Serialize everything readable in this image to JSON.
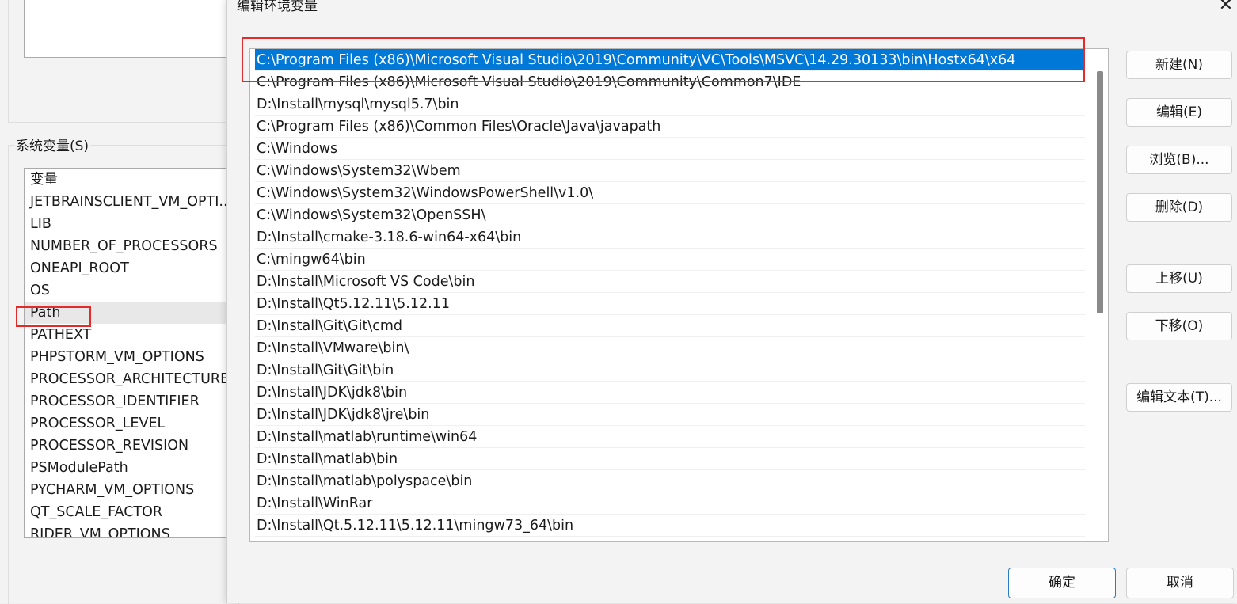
{
  "background_window": {
    "group_label": "系统变量(S)",
    "column_header": "变量",
    "variables": [
      "JETBRAINSCLIENT_VM_OPTI...",
      "LIB",
      "NUMBER_OF_PROCESSORS",
      "ONEAPI_ROOT",
      "OS",
      "Path",
      "PATHEXT",
      "PHPSTORM_VM_OPTIONS",
      "PROCESSOR_ARCHITECTURE",
      "PROCESSOR_IDENTIFIER",
      "PROCESSOR_LEVEL",
      "PROCESSOR_REVISION",
      "PSModulePath",
      "PYCHARM_VM_OPTIONS",
      "QT_SCALE_FACTOR",
      "RIDER_VM_OPTIONS"
    ],
    "selected_variable": "Path"
  },
  "dialog": {
    "title": "编辑环境变量",
    "close_glyph": "✕",
    "paths": [
      "C:\\Program Files (x86)\\Microsoft Visual Studio\\2019\\Community\\VC\\Tools\\MSVC\\14.29.30133\\bin\\Hostx64\\x64",
      "C:\\Program Files (x86)\\Microsoft Visual Studio\\2019\\Community\\Common7\\IDE",
      "D:\\Install\\mysql\\mysql5.7\\bin",
      "C:\\Program Files (x86)\\Common Files\\Oracle\\Java\\javapath",
      "C:\\Windows",
      "C:\\Windows\\System32\\Wbem",
      "C:\\Windows\\System32\\WindowsPowerShell\\v1.0\\",
      "C:\\Windows\\System32\\OpenSSH\\",
      "D:\\Install\\cmake-3.18.6-win64-x64\\bin",
      "C:\\mingw64\\bin",
      "D:\\Install\\Microsoft VS Code\\bin",
      "D:\\Install\\Qt5.12.11\\5.12.11",
      "D:\\Install\\Git\\Git\\cmd",
      "D:\\Install\\VMware\\bin\\",
      "D:\\Install\\Git\\Git\\bin",
      "D:\\Install\\JDK\\jdk8\\bin",
      "D:\\Install\\JDK\\jdk8\\jre\\bin",
      "D:\\Install\\matlab\\runtime\\win64",
      "D:\\Install\\matlab\\bin",
      "D:\\Install\\matlab\\polyspace\\bin",
      "D:\\Install\\WinRar",
      "D:\\Install\\Qt.5.12.11\\5.12.11\\mingw73_64\\bin"
    ],
    "selected_index": 0,
    "buttons": {
      "new": "新建(N)",
      "edit": "编辑(E)",
      "browse": "浏览(B)...",
      "delete": "删除(D)",
      "move_up": "上移(U)",
      "move_down": "下移(O)",
      "edit_text": "编辑文本(T)...",
      "ok": "确定",
      "cancel": "取消"
    }
  },
  "colors": {
    "selection": "#0078d7",
    "annotation": "#e32b2b"
  }
}
